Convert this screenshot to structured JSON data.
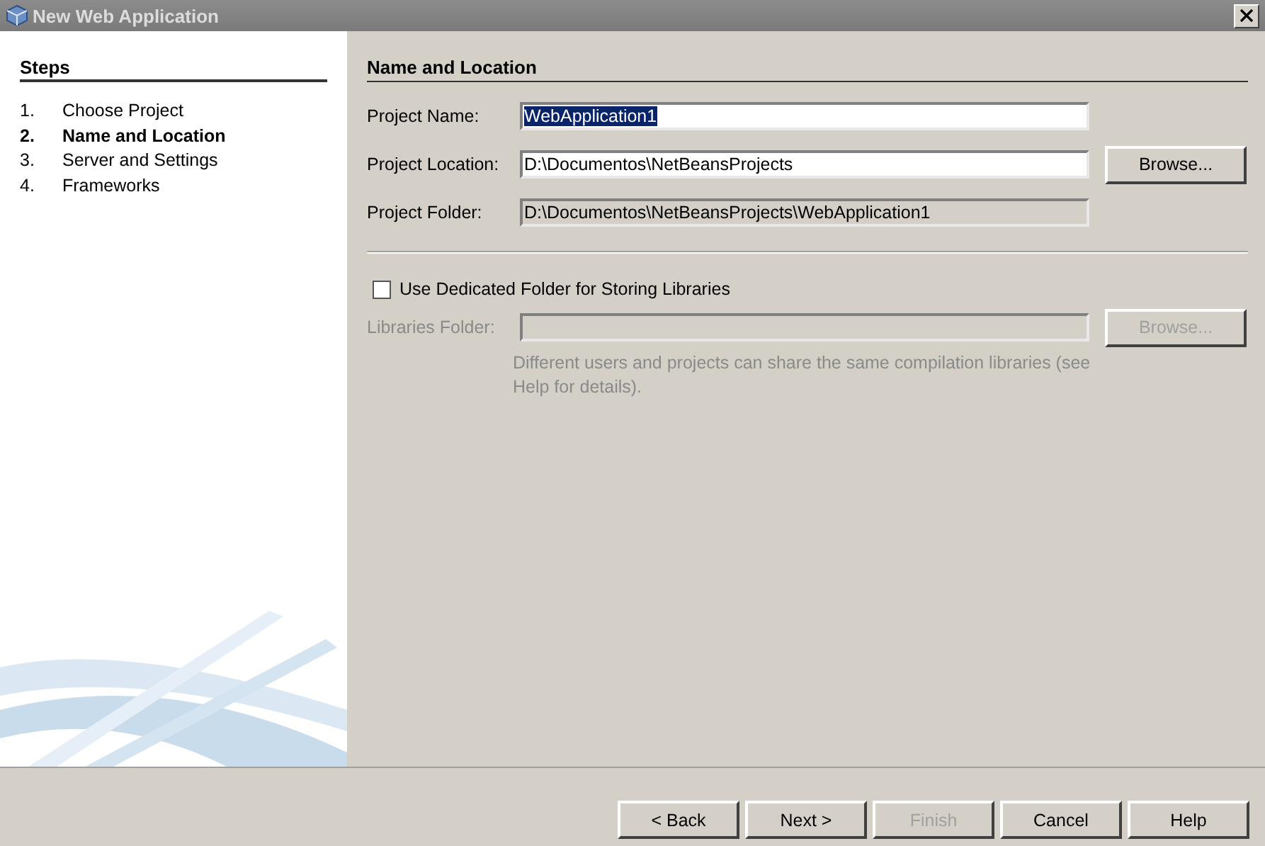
{
  "window": {
    "title": "New Web Application"
  },
  "steps": {
    "title": "Steps",
    "items": [
      {
        "number": "1.",
        "label": "Choose Project",
        "selected": false
      },
      {
        "number": "2.",
        "label": "Name and Location",
        "selected": true
      },
      {
        "number": "3.",
        "label": "Server and Settings",
        "selected": false
      },
      {
        "number": "4.",
        "label": "Frameworks",
        "selected": false
      }
    ]
  },
  "panel": {
    "title": "Name and Location",
    "fields": [
      {
        "label": "Project Name:",
        "value": "WebApplication1",
        "editable": true,
        "text_selected": true
      },
      {
        "label": "Project Location:",
        "value": "D:\\Documentos\\NetBeansProjects",
        "editable": true,
        "text_selected": false,
        "button": {
          "label": "Browse...",
          "disabled": false
        }
      },
      {
        "label": "Project Folder:",
        "value": "D:\\Documentos\\NetBeansProjects\\WebApplication1",
        "editable": false,
        "text_selected": false
      }
    ],
    "checkbox": {
      "label": "Use Dedicated Folder for Storing Libraries",
      "checked": false
    },
    "libraries": {
      "label": "Libraries Folder:",
      "disabled": true,
      "button": {
        "label": "Browse...",
        "disabled": true
      }
    },
    "hint": "Different users and projects can share the same compilation libraries (see Help for details)."
  },
  "buttons": [
    {
      "label": "< Back",
      "disabled": false
    },
    {
      "label": "Next >",
      "disabled": false
    },
    {
      "label": "Finish",
      "disabled": true
    },
    {
      "label": "Cancel",
      "disabled": false
    },
    {
      "label": "Help",
      "disabled": false
    }
  ]
}
